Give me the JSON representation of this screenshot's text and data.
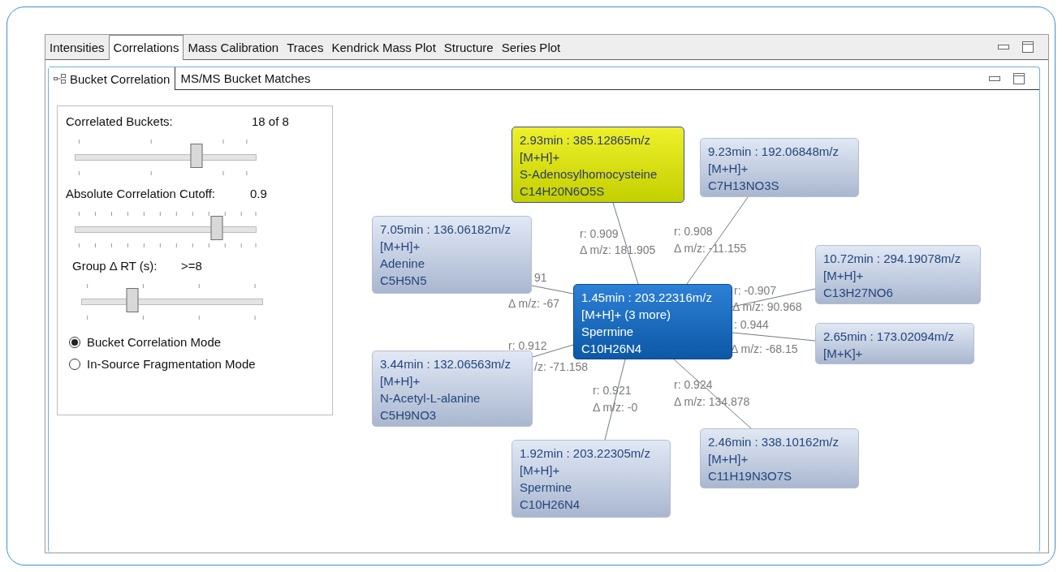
{
  "main_tabs": [
    {
      "label": "Intensities",
      "selected": false
    },
    {
      "label": "Correlations",
      "selected": true
    },
    {
      "label": "Mass Calibration",
      "selected": false
    },
    {
      "label": "Traces",
      "selected": false
    },
    {
      "label": "Kendrick Mass Plot",
      "selected": false
    },
    {
      "label": "Structure",
      "selected": false
    },
    {
      "label": "Series Plot",
      "selected": false
    }
  ],
  "sub_tabs": [
    {
      "label": "Bucket Correlation",
      "selected": true,
      "kind": "graph"
    },
    {
      "label": "MS/MS Bucket Matches",
      "selected": false,
      "kind": "plain"
    }
  ],
  "controls": {
    "sliders": [
      {
        "label": "Correlated Buckets:",
        "value": "18 of 8",
        "level": 0.67
      },
      {
        "label": "Absolute Correlation Cutoff:",
        "value": "0.9",
        "level": 0.78
      },
      {
        "label": "Group Δ RT (s):",
        "value": ">=8",
        "level": 0.28
      }
    ],
    "modes": [
      {
        "label": "Bucket Correlation Mode",
        "selected": true
      },
      {
        "label": "In-Source Fragmentation Mode",
        "selected": false
      }
    ]
  },
  "graph": {
    "center": {
      "kind": "focused",
      "lines": [
        "1.45min : 203.22316m/z",
        "[M+H]+ (3 more)",
        "Spermine",
        "C10H26N4"
      ]
    },
    "nodes": [
      {
        "kind": "highlighted",
        "lines": [
          "2.93min : 385.12865m/z",
          "[M+H]+",
          "S-Adenosylhomocysteine",
          "C14H20N6O5S"
        ],
        "r": "r: 0.909",
        "delta": "Δ m/z: 181.905"
      },
      {
        "kind": "normal",
        "lines": [
          "9.23min : 192.06848m/z",
          "[M+H]+",
          "C7H13NO3S"
        ],
        "r": "r: 0.908",
        "delta": "Δ m/z: -11.155"
      },
      {
        "kind": "normal",
        "lines": [
          "7.05min : 136.06182m/z",
          "[M+H]+",
          "Adenine",
          "C5H5N5"
        ],
        "r": "91",
        "delta": "Δ m/z: -67"
      },
      {
        "kind": "normal",
        "lines": [
          "10.72min : 294.19078m/z",
          "[M+H]+",
          "C13H27NO6"
        ],
        "r": "r: -0.907",
        "delta": "Δ m/z: 90.968"
      },
      {
        "kind": "normal",
        "lines": [
          "2.65min : 173.02094m/z",
          "[M+K]+"
        ],
        "r": ": 0.944",
        "delta": "Δ m/z: -68.15"
      },
      {
        "kind": "normal",
        "lines": [
          "3.44min : 132.06563m/z",
          "[M+H]+",
          "N-Acetyl-L-alanine",
          "C5H9NO3"
        ],
        "r": "r: 0.912",
        "delta": "/z: -71.158"
      },
      {
        "kind": "normal",
        "lines": [
          "1.92min : 203.22305m/z",
          "[M+H]+",
          "Spermine",
          "C10H26N4"
        ],
        "r": "r: 0.921",
        "delta": "Δ m/z: -0"
      },
      {
        "kind": "normal",
        "lines": [
          "2.46min : 338.10162m/z",
          "[M+H]+",
          "C11H19N3O7S"
        ],
        "r": "r: 0.924",
        "delta": "Δ m/z: 134.878"
      }
    ]
  }
}
